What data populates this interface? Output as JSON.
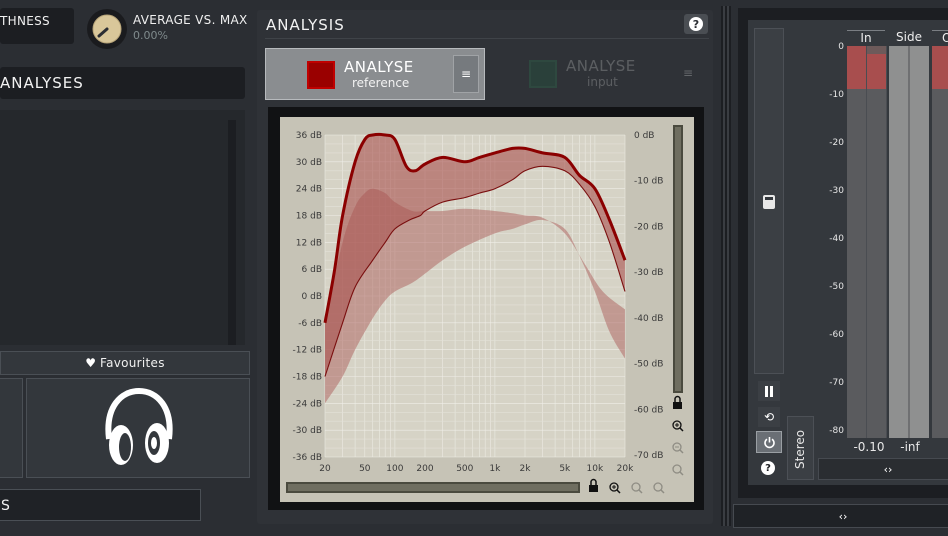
{
  "left": {
    "smoothness_label": "THNESS",
    "avg_label": "AVERAGE VS. MAX",
    "avg_value": "0.00%",
    "analyses_title": "ANALYSES",
    "favourites_label": "Favourites",
    "bottom_label": "S"
  },
  "analysis": {
    "title": "ANALYSIS",
    "help": "?",
    "ref_button": {
      "title": "ANALYSE",
      "sub": "reference",
      "color": "#c00000"
    },
    "input_button": {
      "title": "ANALYSE",
      "sub": "input",
      "color": "#2e8b57"
    },
    "menu_glyph": "≡"
  },
  "chart_data": {
    "type": "area",
    "x_ticks": [
      "20",
      "50",
      "100",
      "200",
      "500",
      "1k",
      "2k",
      "5k",
      "10k",
      "20k"
    ],
    "x_tick_values": [
      20,
      50,
      100,
      200,
      500,
      1000,
      2000,
      5000,
      10000,
      20000
    ],
    "y_ticks_left": [
      "36 dB",
      "30 dB",
      "24 dB",
      "18 dB",
      "12 dB",
      "6 dB",
      "0 dB",
      "-6 dB",
      "-12 dB",
      "-18 dB",
      "-24 dB",
      "-30 dB",
      "-36 dB"
    ],
    "y_ticks_right": [
      "0 dB",
      "-10 dB",
      "-20 dB",
      "-30 dB",
      "-40 dB",
      "-50 dB",
      "-60 dB",
      "-70 dB"
    ],
    "x_scale": "log",
    "xlim": [
      20,
      20000
    ],
    "ylim": [
      -36,
      36
    ],
    "grid": true,
    "max_curve": [
      [
        20,
        -6
      ],
      [
        25,
        6
      ],
      [
        30,
        18
      ],
      [
        40,
        30
      ],
      [
        50,
        35
      ],
      [
        60,
        36
      ],
      [
        80,
        36
      ],
      [
        100,
        35
      ],
      [
        130,
        29
      ],
      [
        160,
        28
      ],
      [
        200,
        29.5
      ],
      [
        300,
        31
      ],
      [
        500,
        30
      ],
      [
        700,
        31
      ],
      [
        1000,
        32
      ],
      [
        1500,
        33
      ],
      [
        2000,
        33
      ],
      [
        3000,
        32
      ],
      [
        5000,
        31
      ],
      [
        7000,
        27
      ],
      [
        10000,
        24
      ],
      [
        14000,
        17
      ],
      [
        20000,
        8
      ]
    ],
    "upper_band": [
      [
        20,
        -6
      ],
      [
        30,
        12
      ],
      [
        40,
        20
      ],
      [
        50,
        23
      ],
      [
        60,
        24
      ],
      [
        80,
        23
      ],
      [
        100,
        21
      ],
      [
        150,
        19
      ],
      [
        200,
        19
      ],
      [
        300,
        19
      ],
      [
        500,
        19.5
      ],
      [
        1000,
        19
      ],
      [
        1500,
        18.5
      ],
      [
        2000,
        18
      ],
      [
        3000,
        17.5
      ],
      [
        5000,
        14
      ],
      [
        8000,
        7
      ],
      [
        12000,
        1
      ],
      [
        20000,
        -3
      ]
    ],
    "lower_band": [
      [
        20,
        -24
      ],
      [
        30,
        -18
      ],
      [
        40,
        -12
      ],
      [
        60,
        -5
      ],
      [
        80,
        -1
      ],
      [
        100,
        1
      ],
      [
        150,
        3
      ],
      [
        200,
        5
      ],
      [
        300,
        8
      ],
      [
        500,
        11
      ],
      [
        1000,
        14
      ],
      [
        1500,
        15
      ],
      [
        2000,
        16
      ],
      [
        3000,
        17
      ],
      [
        5000,
        15
      ],
      [
        7000,
        9
      ],
      [
        10000,
        1
      ],
      [
        14000,
        -8
      ],
      [
        20000,
        -14
      ]
    ],
    "avg_curve": [
      [
        20,
        -18
      ],
      [
        30,
        -6
      ],
      [
        40,
        2
      ],
      [
        60,
        8
      ],
      [
        80,
        12
      ],
      [
        100,
        15
      ],
      [
        140,
        17
      ],
      [
        180,
        18
      ],
      [
        200,
        19
      ],
      [
        300,
        21
      ],
      [
        500,
        22
      ],
      [
        700,
        23
      ],
      [
        1000,
        24
      ],
      [
        1500,
        26
      ],
      [
        2000,
        28
      ],
      [
        3000,
        29
      ],
      [
        5000,
        28
      ],
      [
        7000,
        25
      ],
      [
        10000,
        20
      ],
      [
        14000,
        12
      ],
      [
        20000,
        1
      ]
    ]
  },
  "meter": {
    "columns": [
      "In",
      "Side",
      "O"
    ],
    "ticks": [
      "0",
      "-10",
      "-20",
      "-30",
      "-40",
      "-50",
      "-60",
      "-70",
      "-80"
    ],
    "tick_values": [
      0,
      -10,
      -20,
      -30,
      -40,
      -50,
      -60,
      -70,
      -80
    ],
    "in_value": "-0.10",
    "side_value": "-inf",
    "in_level_db": -9,
    "stereo_label": "Stereo",
    "arrows": "‹›"
  }
}
